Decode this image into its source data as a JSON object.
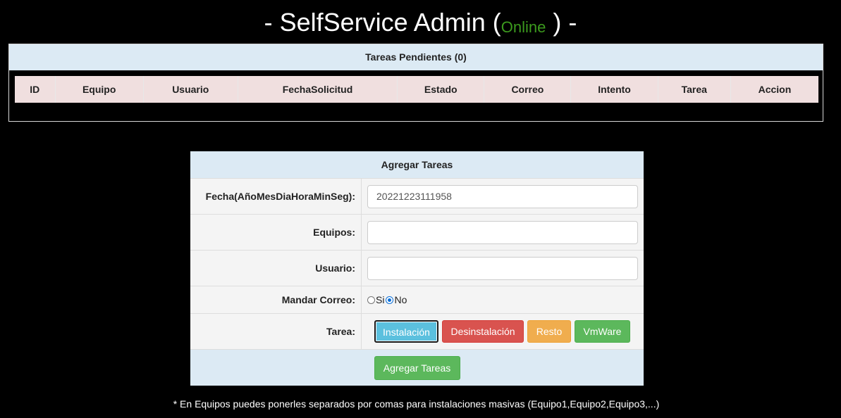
{
  "header": {
    "title_prefix": "- SelfService Admin (",
    "status": "Online",
    "title_suffix": " ) -",
    "status_color": "#3c9a1e"
  },
  "pending": {
    "title": "Tareas Pendientes (0)",
    "columns": [
      "ID",
      "Equipo",
      "Usuario",
      "FechaSolicitud",
      "Estado",
      "Correo",
      "Intento",
      "Tarea",
      "Accion"
    ]
  },
  "form": {
    "title": "Agregar Tareas",
    "fecha_label": "Fecha(AñoMesDiaHoraMinSeg):",
    "fecha_value": "20221223111958",
    "equipos_label": "Equipos:",
    "equipos_value": "",
    "usuario_label": "Usuario:",
    "usuario_value": "",
    "correo_label": "Mandar Correo:",
    "correo_options": [
      "Si",
      "No"
    ],
    "correo_selected": "No",
    "tarea_label": "Tarea:",
    "tarea_buttons": [
      "Instalación",
      "Desinstalación",
      "Resto",
      "VmWare"
    ],
    "tarea_selected": "Instalación",
    "submit_label": "Agregar Tareas"
  },
  "footnote": "* En Equipos puedes ponerles separados por comas para instalaciones masivas (Equipo1,Equipo2,Equipo3,...)"
}
